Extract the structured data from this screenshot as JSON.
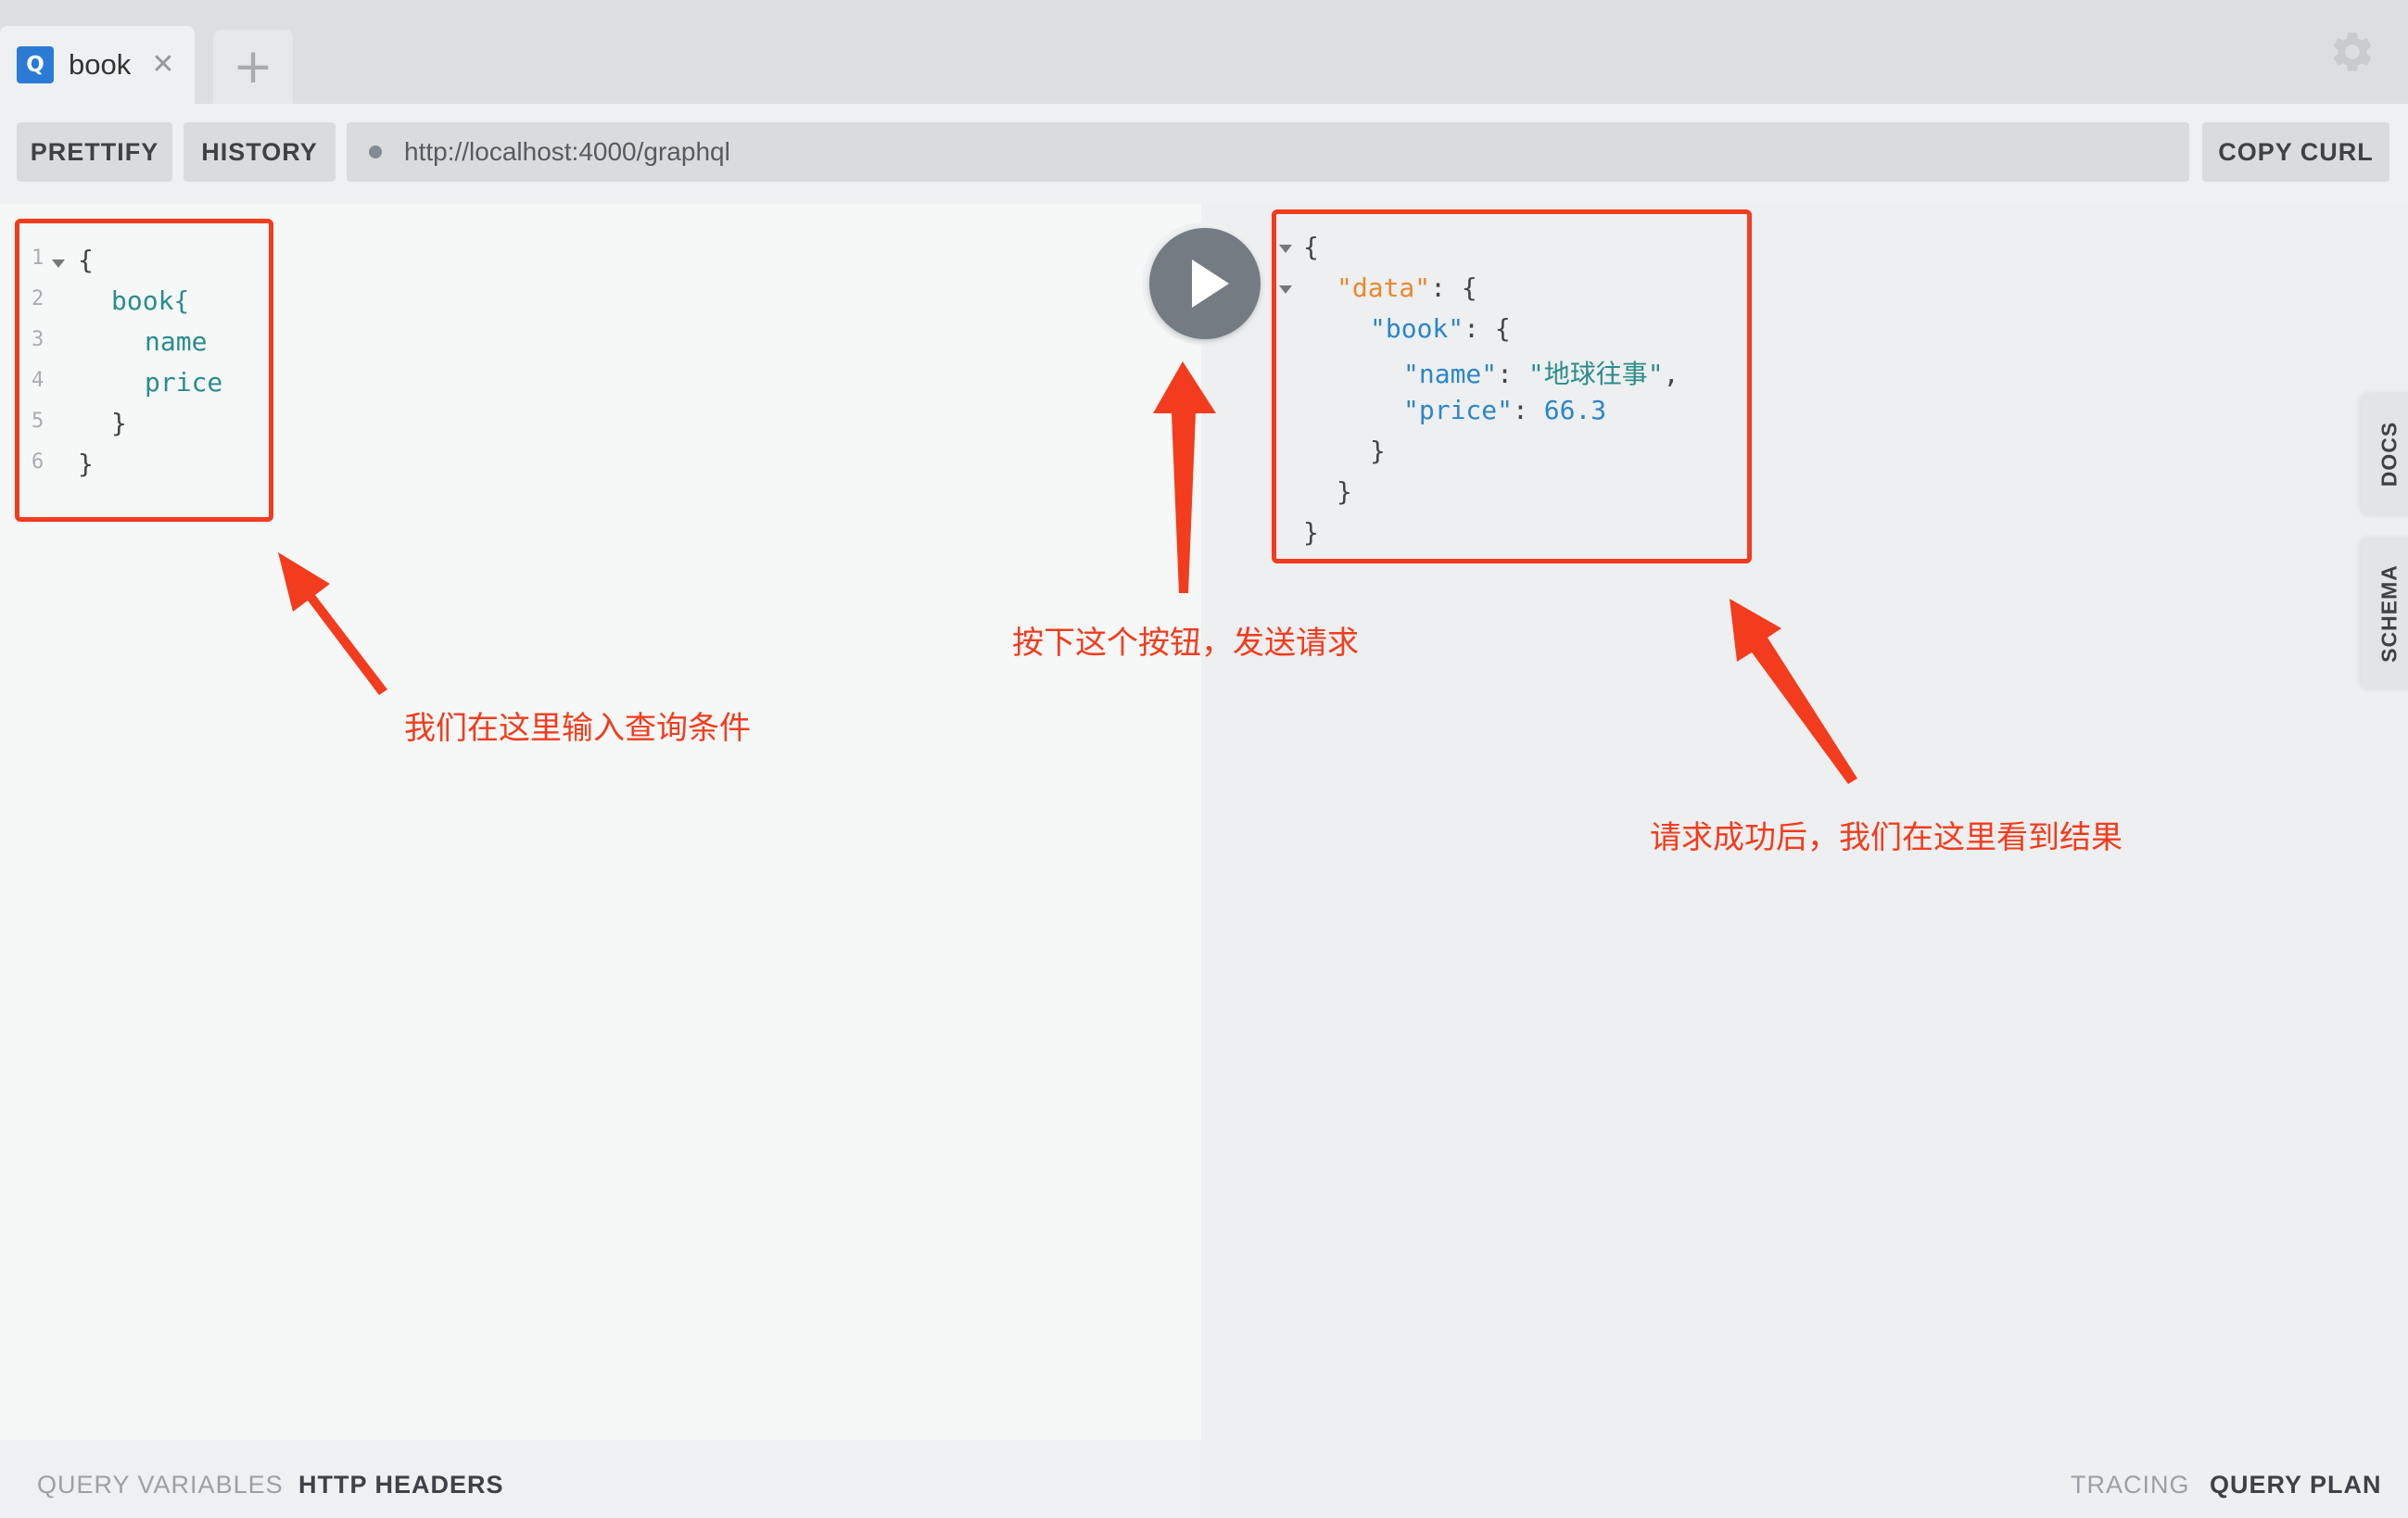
{
  "tabs": [
    {
      "icon_letter": "Q",
      "label": "book",
      "close_glyph": "✕"
    }
  ],
  "add_tab_glyph": "+",
  "toolbar": {
    "prettify_label": "PRETTIFY",
    "history_label": "HISTORY",
    "url": "http://localhost:4000/graphql",
    "copy_curl_label": "COPY CURL"
  },
  "query_editor": {
    "line_numbers": [
      "1",
      "2",
      "3",
      "4",
      "5",
      "6"
    ],
    "lines": [
      "{",
      "book{",
      "name",
      "price",
      "}",
      "}"
    ]
  },
  "result": {
    "open_brace": "{",
    "data_key": "\"data\"",
    "book_key": "\"book\"",
    "name_key": "\"name\"",
    "name_value": "\"地球往事\"",
    "price_key": "\"price\"",
    "price_value": "66.3",
    "colon_brace": ": {",
    "colon": ": ",
    "comma": ",",
    "close_brace": "}"
  },
  "side_tabs": {
    "docs": "DOCS",
    "schema": "SCHEMA"
  },
  "bottom": {
    "query_variables": "QUERY VARIABLES",
    "http_headers": "HTTP HEADERS",
    "tracing": "TRACING",
    "query_plan": "QUERY PLAN"
  },
  "annotations": {
    "input_note": "我们在这里输入查询条件",
    "button_note": "按下这个按钮，发送请求",
    "result_note": "请求成功后，我们在这里看到结果"
  },
  "colors": {
    "annotation_red": "#f23c1d",
    "tab_icon_blue": "#2b7bd6",
    "json_key_blue": "#2b86c9",
    "json_data_orange": "#e6892e",
    "json_string_teal": "#2a8c8c"
  },
  "icons": {
    "settings": "gear-icon",
    "play": "play-icon"
  }
}
